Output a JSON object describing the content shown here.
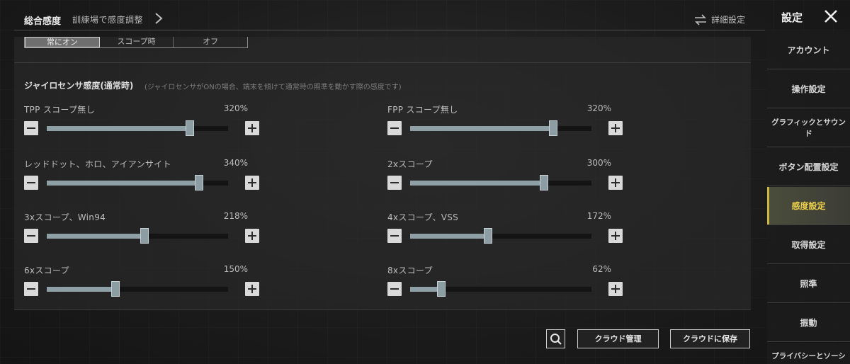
{
  "header": {
    "main": "総合感度",
    "sub": "訓練場で感度調整",
    "advanced": "詳細設定",
    "settings_title": "設定"
  },
  "segment": [
    "常にオン",
    "スコープ時",
    "オフ"
  ],
  "section": {
    "title": "ジャイロセンサ感度(通常時)",
    "note": "(ジャイロセンサがONの場合、端末を傾けて通常時の照準を動かす際の感度です)"
  },
  "sliders": [
    {
      "label": "TPP スコープ無し",
      "value": "320%",
      "level": 0.79
    },
    {
      "label": "FPP スコープ無し",
      "value": "320%",
      "level": 0.79
    },
    {
      "label": "レッドドット、ホロ、アイアンサイト",
      "value": "340%",
      "level": 0.84
    },
    {
      "label": "2xスコープ",
      "value": "300%",
      "level": 0.74
    },
    {
      "label": "3xスコープ、Win94",
      "value": "218%",
      "level": 0.54
    },
    {
      "label": "4xスコープ、VSS",
      "value": "172%",
      "level": 0.43
    },
    {
      "label": "6xスコープ",
      "value": "150%",
      "level": 0.38
    },
    {
      "label": "8xスコープ",
      "value": "62%",
      "level": 0.17
    }
  ],
  "buttons": {
    "cloud_manage": "クラウド管理",
    "cloud_save": "クラウドに保存"
  },
  "sidebar": [
    {
      "label": "アカウント"
    },
    {
      "label": "操作設定"
    },
    {
      "label": "グラフィックとサウンド"
    },
    {
      "label": "ボタン配置設定"
    },
    {
      "label": "感度設定"
    },
    {
      "label": "取得設定"
    },
    {
      "label": "照準"
    },
    {
      "label": "振動"
    },
    {
      "label": "プライバシーとソーシャル"
    }
  ]
}
